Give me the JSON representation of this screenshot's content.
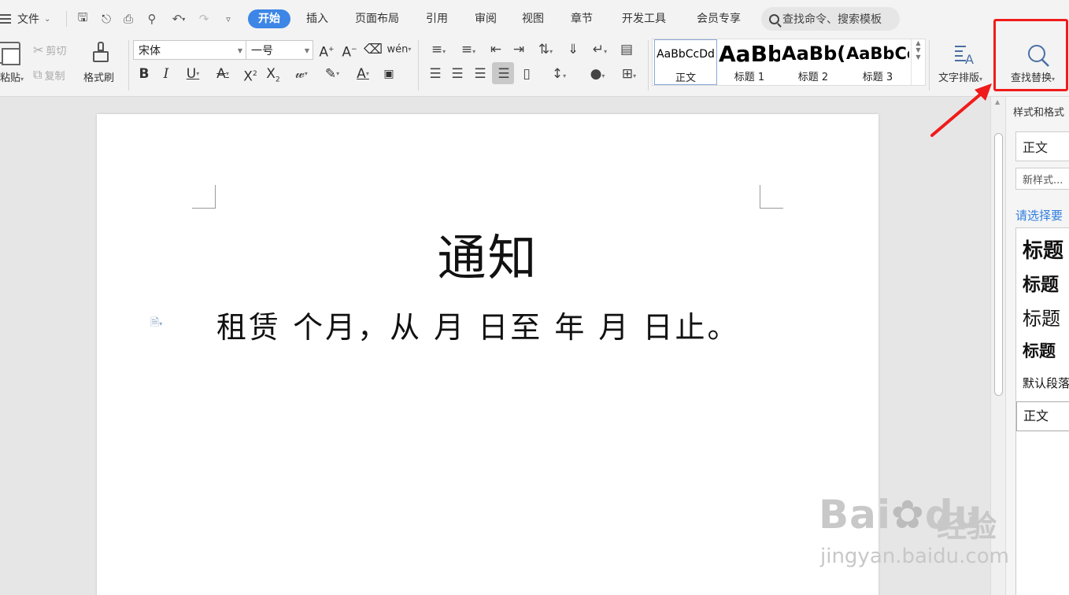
{
  "menu": {
    "file_label": "文件",
    "tabs": [
      {
        "label": "开始",
        "active": true
      },
      {
        "label": "插入"
      },
      {
        "label": "页面布局"
      },
      {
        "label": "引用"
      },
      {
        "label": "审阅"
      },
      {
        "label": "视图"
      },
      {
        "label": "章节"
      },
      {
        "label": "开发工具"
      },
      {
        "label": "会员专享"
      }
    ],
    "search_placeholder": "查找命令、搜索模板"
  },
  "toolbar": {
    "paste_label": "粘贴",
    "cut_label": "剪切",
    "copy_label": "复制",
    "format_painter_label": "格式刷",
    "font_name": "宋体",
    "font_size": "一号",
    "styles": [
      {
        "preview": "AaBbCcDd",
        "label": "正文"
      },
      {
        "preview": "AaBb",
        "label": "标题 1"
      },
      {
        "preview": "AaBb(",
        "label": "标题 2"
      },
      {
        "preview": "AaBbCc",
        "label": "标题 3"
      }
    ],
    "text_layout_label": "文字排版",
    "find_replace_label": "查找替换"
  },
  "document": {
    "title": "通知",
    "body": "租赁 个月，从 月 日至 年 月 日止。"
  },
  "styles_pane": {
    "title": "样式和格式",
    "current_style": "正文",
    "new_style_button": "新样式...",
    "prompt": "请选择要",
    "items": [
      {
        "label": "标题",
        "size": 26
      },
      {
        "label": "标题",
        "size": 23
      },
      {
        "label": "标题",
        "size": 24
      },
      {
        "label": "标题",
        "size": 21
      },
      {
        "label": "默认段落",
        "size": 15
      }
    ],
    "bottom_style": "正文"
  },
  "watermark": {
    "brand": "Bai",
    "brand_tail": "du",
    "cn": "经验",
    "url": "jingyan.baidu.com"
  },
  "colors": {
    "accent": "#3d86e6",
    "highlight": "#f01b1b",
    "link": "#2f7de1"
  }
}
